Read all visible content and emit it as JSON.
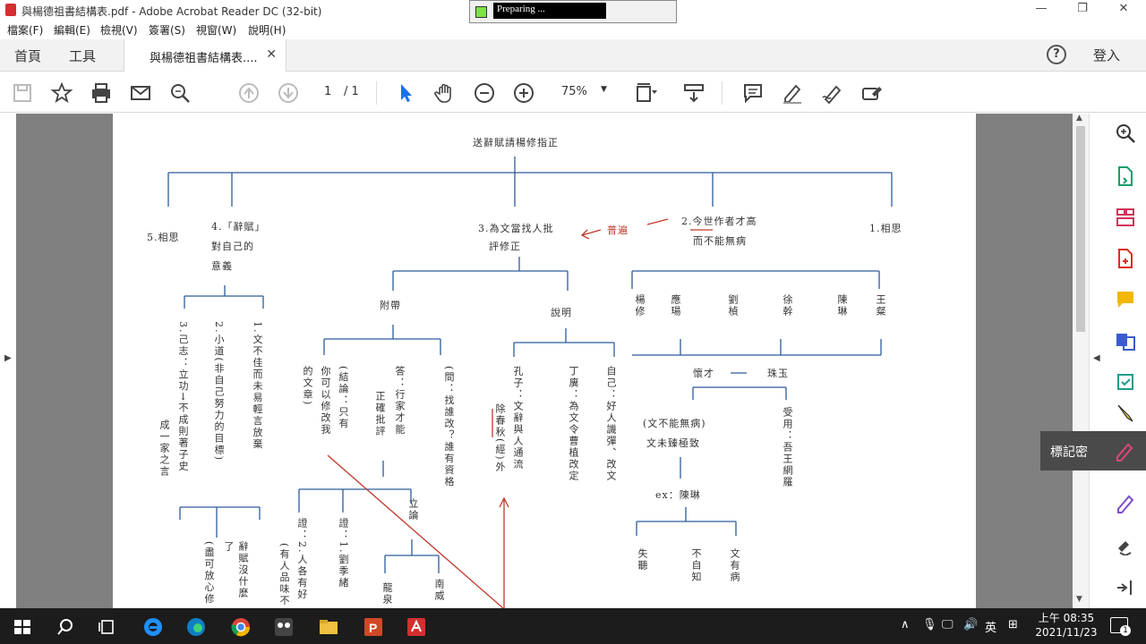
{
  "window": {
    "title": "與楊德祖書結構表.pdf - Adobe Acrobat Reader DC (32-bit)",
    "minimize": "—",
    "restore": "❐",
    "close": "✕"
  },
  "preparing": {
    "label": "Preparing ..."
  },
  "menu": [
    "檔案(F)",
    "編輯(E)",
    "檢視(V)",
    "簽署(S)",
    "視窗(W)",
    "說明(H)"
  ],
  "tabs": {
    "home": "首頁",
    "tools": "工具",
    "document": "與楊德祖書結構表....",
    "close": "✕",
    "help": "?",
    "login": "登入"
  },
  "toolbar": {
    "page_current": "1",
    "page_total": "/ 1",
    "zoom": "75%"
  },
  "tooltip": {
    "label": "標記密"
  },
  "diagram": {
    "title": "送辭賦請楊修指正",
    "n5": "5.相思",
    "n4_a": "4.「辭賦」",
    "n4_b": "對自己的",
    "n4_c": "意義",
    "n3_a": "3.為文當找人批",
    "n3_b": "評修正",
    "n2_a": "2.今世作者才高",
    "n2_b": "而不能無病",
    "n1": "1.相思",
    "annot": "普遍",
    "fudai": "附帶",
    "shuoming": "說明",
    "n4_1": "1.文不佳而未易輕言放棄",
    "n4_2": "2.小道(非自己努力的目標)",
    "n4_3": "3.己志：立功→不成則著子史",
    "n4_3b": "成一家之言",
    "n4_bottom1": "辭賦沒什麼了",
    "n4_bottom2": "(盡可放心修",
    "f1": "的文章)",
    "f2": "你可以修改我",
    "f3": "(結論：只有",
    "f4": "答：行家才能",
    "f5": "正確批評",
    "f6": "(問：找誰改？誰有資格",
    "s1": "孔子：文辭與人通流",
    "s1b": "除春秋(經)外",
    "s2": "丁廙：為文令曹植改定",
    "s3": "自己：好人譏彈、改文",
    "lilun": "立論",
    "z1": "證：1.劉季緒",
    "z2": "證：2.人各有好",
    "z2b": "(有人品味不",
    "longquan": "龍泉",
    "nanwei": "南威",
    "w1": "楊修",
    "w2": "應瑒",
    "w3": "劉楨",
    "w4": "徐幹",
    "w5": "陳琳",
    "w6": "王粲",
    "huaicai": "懷才",
    "zhuyu": "珠玉",
    "wb1": "(文不能無病)",
    "wb2": "文未臻極致",
    "shouyong": "受用：吾王網羅",
    "ex": "ex：陳琳",
    "c1": "失聽",
    "c2": "不自知",
    "c3": "文有病"
  },
  "taskbar": {
    "lang": "英",
    "time": "上午 08:35",
    "date": "2021/11/23",
    "notif": "1"
  }
}
